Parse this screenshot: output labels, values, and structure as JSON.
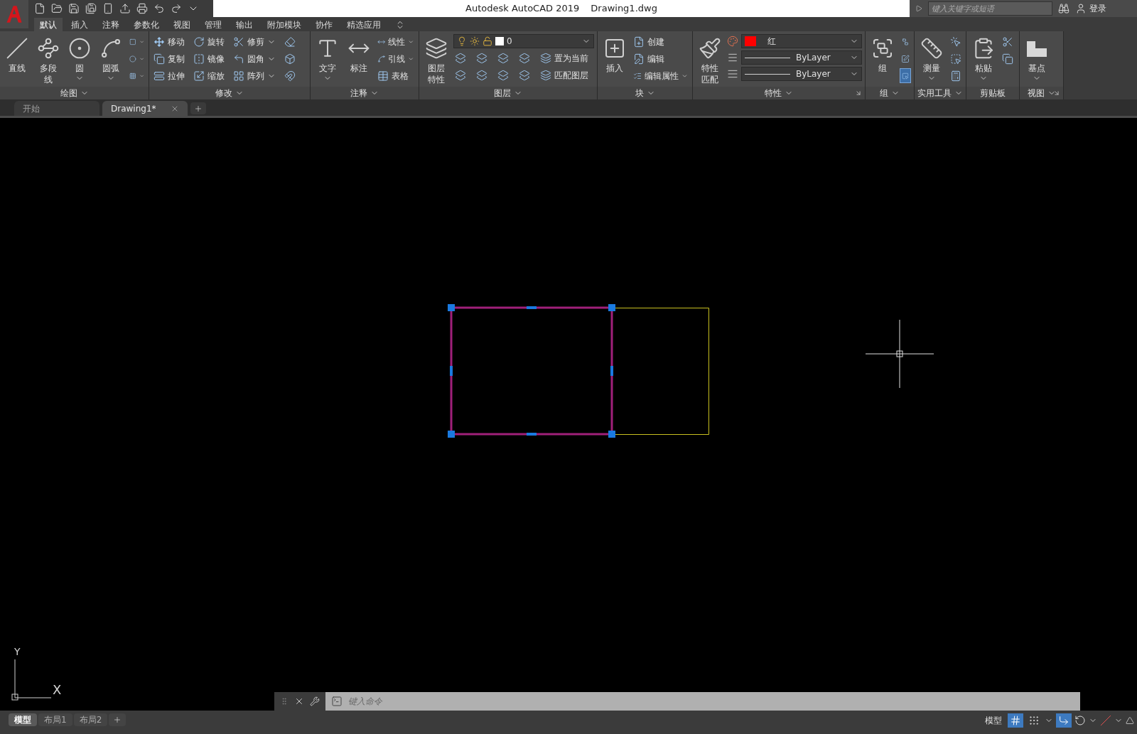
{
  "title_bar": {
    "app": "Autodesk AutoCAD 2019",
    "document": "Drawing1.dwg",
    "search_placeholder": "键入关键字或短语",
    "login": "登录"
  },
  "ribbon_tabs": [
    {
      "label": "默认",
      "selected": true
    },
    {
      "label": "插入",
      "selected": false
    },
    {
      "label": "注释",
      "selected": false
    },
    {
      "label": "参数化",
      "selected": false
    },
    {
      "label": "视图",
      "selected": false
    },
    {
      "label": "管理",
      "selected": false
    },
    {
      "label": "输出",
      "selected": false
    },
    {
      "label": "附加模块",
      "selected": false
    },
    {
      "label": "协作",
      "selected": false
    },
    {
      "label": "精选应用",
      "selected": false
    }
  ],
  "panels": [
    {
      "title": "绘图",
      "caret": true,
      "launcher": false,
      "large": [
        {
          "lines": [
            "直线"
          ],
          "caret": false
        },
        {
          "lines": [
            "多段线"
          ],
          "caret": false
        },
        {
          "lines": [
            "圆"
          ],
          "caret": true
        },
        {
          "lines": [
            "圆弧"
          ],
          "caret": true
        }
      ],
      "small": [
        {
          "caret": true,
          "on": false
        },
        {
          "caret": true,
          "on": false
        },
        {
          "caret": true,
          "on": false
        }
      ]
    },
    {
      "title": "修改",
      "caret": true,
      "launcher": false,
      "small": [
        {
          "label": "移动",
          "caret": false,
          "on": false
        },
        {
          "label": "旋转",
          "caret": false,
          "on": false
        },
        {
          "label": "修剪",
          "caret": true,
          "on": false
        },
        {
          "caret": false,
          "on": false
        },
        {
          "label": "复制",
          "caret": false,
          "on": false
        },
        {
          "label": "镜像",
          "caret": false,
          "on": false
        },
        {
          "label": "圆角",
          "caret": true,
          "on": false
        },
        {
          "caret": false,
          "on": false
        },
        {
          "label": "拉伸",
          "caret": false,
          "on": false
        },
        {
          "label": "缩放",
          "caret": false,
          "on": false
        },
        {
          "label": "阵列",
          "caret": true,
          "on": false
        },
        {
          "caret": false,
          "on": false
        }
      ]
    },
    {
      "title": "注释",
      "caret": true,
      "launcher": false,
      "large": [
        {
          "lines": [
            "文字"
          ],
          "caret": true
        },
        {
          "lines": [
            "标注"
          ],
          "caret": false
        }
      ],
      "small": [
        {
          "label": "线性",
          "caret": true,
          "on": false
        },
        {
          "label": "引线",
          "caret": true,
          "on": false
        },
        {
          "label": "表格",
          "caret": false,
          "on": false
        }
      ]
    },
    {
      "title": "图层",
      "caret": true,
      "launcher": false,
      "large": [
        {
          "lines": [
            "图层",
            "特性"
          ],
          "caret": false
        }
      ],
      "layer": "0",
      "small": [
        {
          "caret": false,
          "on": false
        },
        {
          "caret": false,
          "on": false
        },
        {
          "caret": false,
          "on": false
        },
        {
          "caret": false,
          "on": false
        },
        {
          "label": "置为当前",
          "caret": false,
          "on": false
        },
        {
          "caret": false,
          "on": false
        },
        {
          "caret": false,
          "on": false
        },
        {
          "caret": false,
          "on": false
        },
        {
          "caret": false,
          "on": false
        },
        {
          "label": "匹配图层",
          "caret": false,
          "on": false
        }
      ]
    },
    {
      "title": "块",
      "caret": true,
      "launcher": false,
      "large": [
        {
          "lines": [
            "插入"
          ],
          "caret": false
        }
      ],
      "small": [
        {
          "label": "创建",
          "caret": false,
          "on": false
        },
        {
          "label": "编辑",
          "caret": false,
          "on": false
        },
        {
          "label": "编辑属性",
          "caret": true,
          "on": false
        }
      ]
    },
    {
      "title": "特性",
      "caret": true,
      "launcher": true,
      "large": [
        {
          "lines": [
            "特性",
            "匹配"
          ],
          "caret": false
        }
      ],
      "combos": [
        {
          "kind": "color",
          "value": "红",
          "color": "#ff0000"
        },
        {
          "kind": "linetype",
          "value": "ByLayer"
        },
        {
          "kind": "lineweight",
          "value": "ByLayer"
        }
      ]
    },
    {
      "title": "组",
      "caret": true,
      "launcher": false,
      "large": [
        {
          "lines": [
            "组"
          ],
          "caret": false
        }
      ],
      "small": [
        {
          "caret": false,
          "on": false
        },
        {
          "caret": false,
          "on": false
        },
        {
          "caret": false,
          "on": true
        }
      ]
    },
    {
      "title": "实用工具",
      "caret": true,
      "launcher": false,
      "large": [
        {
          "lines": [
            "测量"
          ],
          "caret": true
        }
      ],
      "small": [
        {
          "caret": false,
          "on": false
        },
        {
          "caret": false,
          "on": false
        },
        {
          "caret": false,
          "on": false
        }
      ]
    },
    {
      "title": "剪贴板",
      "caret": false,
      "launcher": false,
      "large": [
        {
          "lines": [
            "粘贴"
          ],
          "caret": true
        }
      ],
      "small": [
        {
          "caret": false,
          "on": false
        },
        {
          "caret": false,
          "on": false
        }
      ]
    },
    {
      "title": "视图",
      "caret": true,
      "launcher": true,
      "large": [
        {
          "lines": [
            "基点"
          ],
          "caret": true
        }
      ]
    }
  ],
  "doc_tabs": [
    {
      "label": "开始",
      "selected": false,
      "closable": false
    },
    {
      "label": "Drawing1*",
      "selected": true,
      "closable": true
    }
  ],
  "ucs": {
    "y": "Y",
    "x": "X"
  },
  "command_line": {
    "placeholder": "键入命令"
  },
  "layout_tabs": [
    {
      "label": "模型",
      "selected": true
    },
    {
      "label": "布局1",
      "selected": false
    },
    {
      "label": "布局2",
      "selected": false
    }
  ],
  "status_bar": {
    "space": "模型",
    "grid": true,
    "snap": false,
    "ortho": true
  }
}
